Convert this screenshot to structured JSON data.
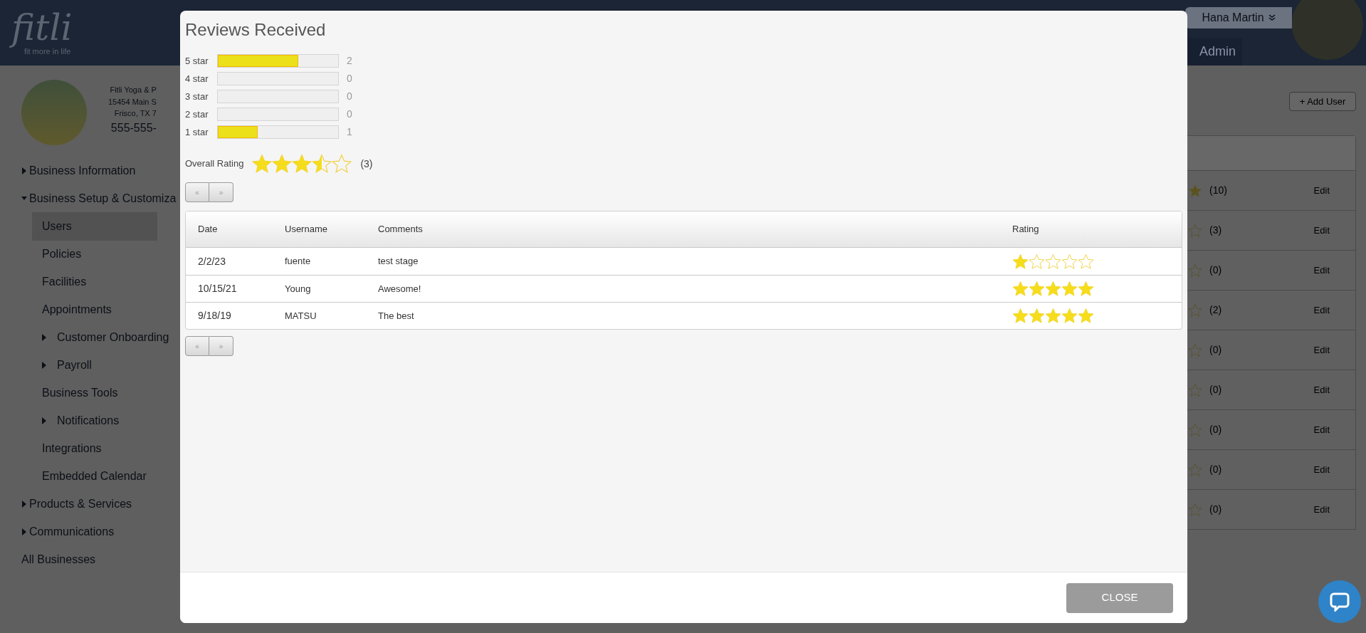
{
  "header": {
    "logo": "fitli",
    "tagline": "fit more in life",
    "user_menu": "Hana Martin",
    "nav_tab": "Admin"
  },
  "business": {
    "name": "Fitli Yoga & P",
    "address": "15454 Main S",
    "city": "Frisco, TX 7",
    "phone": "555-555-"
  },
  "sidebar": {
    "items": [
      {
        "kind": "group",
        "label": "Business Information",
        "expanded": false
      },
      {
        "kind": "group",
        "label": "Business Setup & Customiza",
        "expanded": true,
        "children": [
          {
            "kind": "link",
            "label": "Users",
            "selected": true
          },
          {
            "kind": "link",
            "label": "Policies",
            "selected": false
          },
          {
            "kind": "link",
            "label": "Facilities",
            "selected": false
          },
          {
            "kind": "link",
            "label": "Appointments",
            "selected": false
          },
          {
            "kind": "group",
            "label": "Customer Onboarding",
            "expanded": false
          },
          {
            "kind": "group",
            "label": "Payroll",
            "expanded": false
          },
          {
            "kind": "link",
            "label": "Business Tools",
            "selected": false
          },
          {
            "kind": "group",
            "label": "Notifications",
            "expanded": false
          },
          {
            "kind": "link",
            "label": "Integrations",
            "selected": false
          },
          {
            "kind": "link",
            "label": "Embedded Calendar",
            "selected": false
          }
        ]
      },
      {
        "kind": "group",
        "label": "Products & Services",
        "expanded": false
      },
      {
        "kind": "group",
        "label": "Communications",
        "expanded": false
      },
      {
        "kind": "link",
        "label": "All Businesses",
        "selected": false
      }
    ]
  },
  "users": {
    "add_button": "+ Add User",
    "rows": [
      {
        "star_filled": true,
        "count": "(10)",
        "action": "Edit"
      },
      {
        "star_filled": false,
        "count": "(3)",
        "action": "Edit"
      },
      {
        "star_filled": false,
        "count": "(0)",
        "action": "Edit"
      },
      {
        "star_filled": false,
        "count": "(2)",
        "action": "Edit"
      },
      {
        "star_filled": false,
        "count": "(0)",
        "action": "Edit"
      },
      {
        "star_filled": false,
        "count": "(0)",
        "action": "Edit"
      },
      {
        "star_filled": false,
        "count": "(0)",
        "action": "Edit"
      },
      {
        "star_filled": false,
        "count": "(0)",
        "action": "Edit"
      },
      {
        "star_filled": false,
        "count": "(0)",
        "action": "Edit"
      }
    ]
  },
  "dialog": {
    "title": "Reviews Received",
    "breakdown": [
      {
        "label": "5 star",
        "level": 0.667,
        "count": "2"
      },
      {
        "label": "4 star",
        "level": 0,
        "count": "0"
      },
      {
        "label": "3 star",
        "level": 0,
        "count": "0"
      },
      {
        "label": "2 star",
        "level": 0,
        "count": "0"
      },
      {
        "label": "1 star",
        "level": 0.333,
        "count": "1"
      }
    ],
    "overall": {
      "label": "Overall Rating",
      "stars": 3.5,
      "count": "(3)"
    },
    "pager_top": {
      "prev": "«",
      "next": "»"
    },
    "table": {
      "columns": [
        "Date",
        "Username",
        "Comments",
        "Rating"
      ],
      "rows": [
        {
          "date": "2/2/23",
          "username": "fuente",
          "comment": "test stage",
          "stars": 1
        },
        {
          "date": "10/15/21",
          "username": "Young",
          "comment": "Awesome!",
          "stars": 5
        },
        {
          "date": "9/18/19",
          "username": "MATSU",
          "comment": "The best",
          "stars": 5
        }
      ]
    },
    "pager_bottom": {
      "prev": "«",
      "next": "»"
    },
    "close_button": "CLOSE"
  }
}
